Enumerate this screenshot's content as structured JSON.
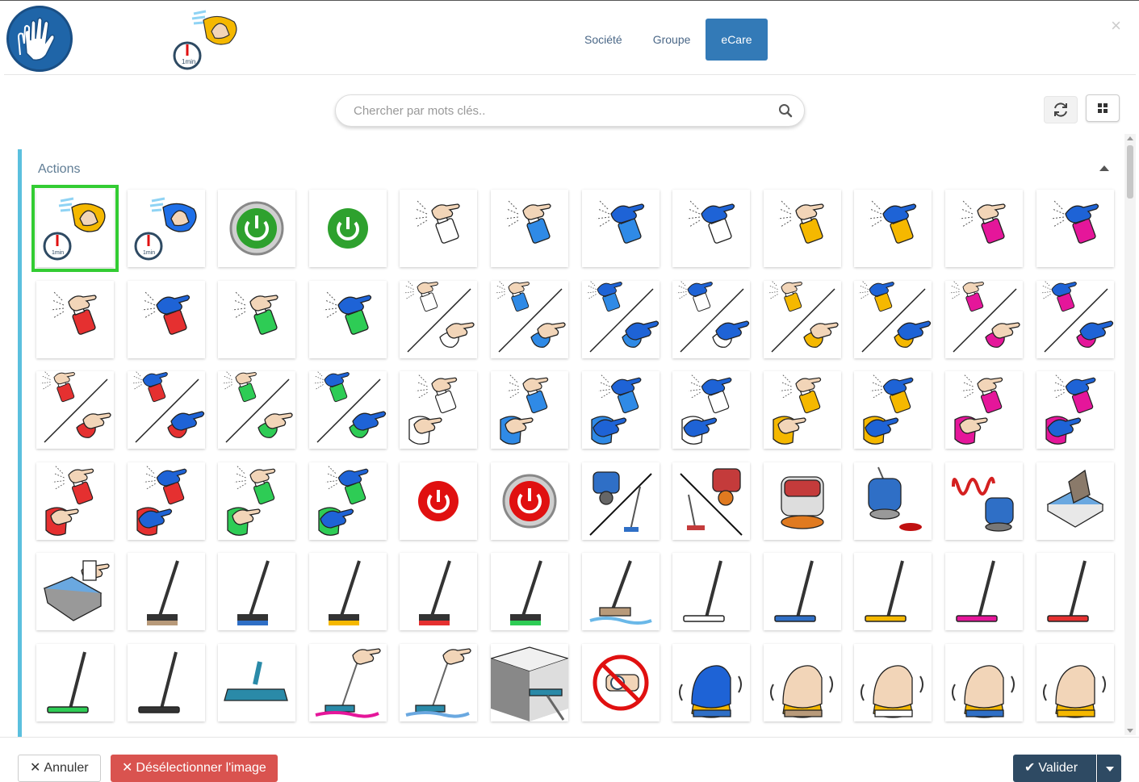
{
  "header": {
    "tabs": [
      {
        "label": "Société",
        "active": false
      },
      {
        "label": "Groupe",
        "active": false
      },
      {
        "label": "eCare",
        "active": true
      }
    ],
    "close_icon": "close-icon",
    "logo_icon": "gloves-icon",
    "preview_icon": "wipe-1min-icon"
  },
  "search": {
    "placeholder": "Chercher par mots clés..",
    "value": ""
  },
  "toolbar": {
    "refresh_icon": "refresh-icon",
    "grid_icon": "grid-view-icon"
  },
  "section": {
    "title": "Actions",
    "collapse_icon": "chevron-up-icon"
  },
  "footer": {
    "cancel_label": "Annuler",
    "deselect_label": "Désélectionner l'image",
    "validate_label": "Valider"
  },
  "colors": {
    "accent": "#337ab7",
    "panel_border": "#5bc0de",
    "selected": "#33cc33",
    "danger": "#d9534f",
    "primary_dark": "#2e4a63"
  },
  "tiles": [
    {
      "icon": "wipe-1min",
      "color": "#f5b800"
    },
    {
      "icon": "wipe-1min",
      "color": "#1e6fe8"
    },
    {
      "icon": "power-metal",
      "color": "#2ea12e"
    },
    {
      "icon": "power",
      "color": "#2ea12e"
    },
    {
      "icon": "spray",
      "color": "#ffffff",
      "glove": false
    },
    {
      "icon": "spray",
      "color": "#2f8ae6",
      "glove": false
    },
    {
      "icon": "spray",
      "color": "#2f8ae6",
      "glove": true
    },
    {
      "icon": "spray",
      "color": "#ffffff",
      "glove": true
    },
    {
      "icon": "spray",
      "color": "#f5b800",
      "glove": false
    },
    {
      "icon": "spray",
      "color": "#f5b800",
      "glove": true
    },
    {
      "icon": "spray",
      "color": "#e5169a",
      "glove": false
    },
    {
      "icon": "spray",
      "color": "#e5169a",
      "glove": true
    },
    {
      "icon": "spray",
      "color": "#e53030",
      "glove": false
    },
    {
      "icon": "spray",
      "color": "#e53030",
      "glove": true
    },
    {
      "icon": "spray",
      "color": "#2ecc55",
      "glove": false
    },
    {
      "icon": "spray",
      "color": "#2ecc55",
      "glove": true
    },
    {
      "icon": "spray-wipe",
      "color": "#ffffff",
      "glove": false
    },
    {
      "icon": "spray-wipe",
      "color": "#2f8ae6",
      "glove": false
    },
    {
      "icon": "spray-wipe",
      "color": "#2f8ae6",
      "glove": true
    },
    {
      "icon": "spray-wipe",
      "color": "#ffffff",
      "glove": true
    },
    {
      "icon": "spray-wipe",
      "color": "#f5b800",
      "glove": false
    },
    {
      "icon": "spray-wipe",
      "color": "#f5b800",
      "glove": true
    },
    {
      "icon": "spray-wipe",
      "color": "#e5169a",
      "glove": false
    },
    {
      "icon": "spray-wipe",
      "color": "#e5169a",
      "glove": true
    },
    {
      "icon": "spray-wipe",
      "color": "#e53030",
      "glove": false
    },
    {
      "icon": "spray-wipe",
      "color": "#e53030",
      "glove": true
    },
    {
      "icon": "spray-wipe",
      "color": "#2ecc55",
      "glove": false
    },
    {
      "icon": "spray-wipe",
      "color": "#2ecc55",
      "glove": true
    },
    {
      "icon": "spray-cloth",
      "color": "#ffffff",
      "glove": false
    },
    {
      "icon": "spray-cloth",
      "color": "#2f8ae6",
      "glove": false
    },
    {
      "icon": "spray-cloth",
      "color": "#2f8ae6",
      "glove": true
    },
    {
      "icon": "spray-cloth",
      "color": "#ffffff",
      "glove": true
    },
    {
      "icon": "spray-cloth",
      "color": "#f5b800",
      "glove": false
    },
    {
      "icon": "spray-cloth",
      "color": "#f5b800",
      "glove": true
    },
    {
      "icon": "spray-cloth",
      "color": "#e5169a",
      "glove": false
    },
    {
      "icon": "spray-cloth",
      "color": "#e5169a",
      "glove": true
    },
    {
      "icon": "spray-cloth",
      "color": "#e53030",
      "glove": false
    },
    {
      "icon": "spray-cloth",
      "color": "#e53030",
      "glove": true
    },
    {
      "icon": "spray-cloth",
      "color": "#2ecc55",
      "glove": false
    },
    {
      "icon": "spray-cloth",
      "color": "#2ecc55",
      "glove": true
    },
    {
      "icon": "power",
      "color": "#e01010"
    },
    {
      "icon": "power-metal",
      "color": "#e01010"
    },
    {
      "icon": "scrubber-broom",
      "color": "#2f6fc6"
    },
    {
      "icon": "broom-scrubber",
      "color": "#c43b3b"
    },
    {
      "icon": "scrubber",
      "color": "#c43b3b"
    },
    {
      "icon": "scrubber-pad",
      "color": "#2f6fc6"
    },
    {
      "icon": "heat-scrubber",
      "color": "#d42020"
    },
    {
      "icon": "tray",
      "color": "#6aa8e0"
    },
    {
      "icon": "tray-spray",
      "color": "#6aa8e0"
    },
    {
      "icon": "broom",
      "color": "#b89a7a"
    },
    {
      "icon": "broom",
      "color": "#2f6fc6"
    },
    {
      "icon": "broom",
      "color": "#f5b800"
    },
    {
      "icon": "broom",
      "color": "#e53030"
    },
    {
      "icon": "broom",
      "color": "#2ecc55"
    },
    {
      "icon": "broom-water",
      "color": "#b89a7a"
    },
    {
      "icon": "squeegee",
      "color": "#ffffff"
    },
    {
      "icon": "squeegee",
      "color": "#2f6fc6"
    },
    {
      "icon": "squeegee",
      "color": "#f5b800"
    },
    {
      "icon": "squeegee",
      "color": "#e5169a"
    },
    {
      "icon": "squeegee",
      "color": "#e53030"
    },
    {
      "icon": "squeegee",
      "color": "#2ecc55"
    },
    {
      "icon": "squeegee",
      "color": "#333333"
    },
    {
      "icon": "flat-mop",
      "color": "#2a8aa8"
    },
    {
      "icon": "mop-wet",
      "color": "#e5169a"
    },
    {
      "icon": "mop-wet",
      "color": "#6aa8e0"
    },
    {
      "icon": "ceiling-mop",
      "color": "#2a8aa8"
    },
    {
      "icon": "no-watch",
      "color": "#e01010"
    },
    {
      "icon": "hand-brush",
      "color": "#2f6fc6",
      "glove": true
    },
    {
      "icon": "hand-brush",
      "color": "#b89a7a"
    },
    {
      "icon": "hand-brush",
      "color": "#ffffff"
    },
    {
      "icon": "hand-brush",
      "color": "#2f6fc6"
    },
    {
      "icon": "hand-brush",
      "color": "#f5b800"
    }
  ]
}
